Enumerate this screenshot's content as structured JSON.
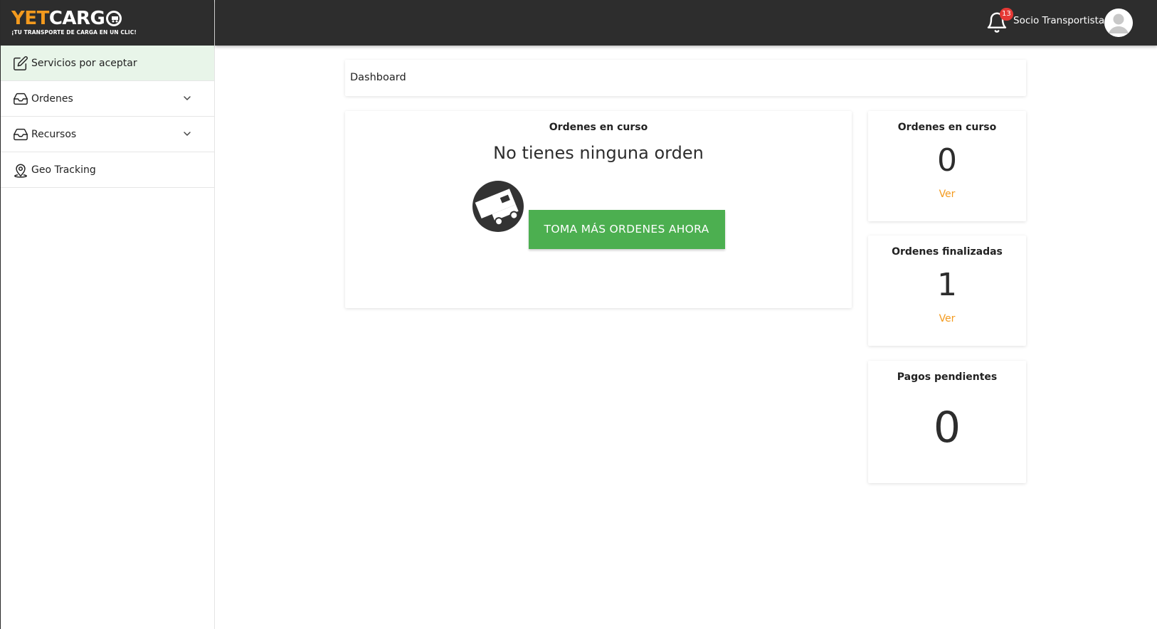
{
  "brand": {
    "word_yet": "YET",
    "word_cargo": "CARG",
    "tagline": "¡TU TRANSPORTE DE CARGA EN UN CLIC!",
    "accent_color": "#f39a1e"
  },
  "sidebar": {
    "items": [
      {
        "label": "Servicios por aceptar",
        "icon": "edit-icon",
        "active": true
      },
      {
        "label": "Ordenes",
        "icon": "inbox-icon",
        "expandable": true
      },
      {
        "label": "Recursos",
        "icon": "inbox-icon",
        "expandable": true
      },
      {
        "label": "Geo Tracking",
        "icon": "location-pin-icon"
      }
    ]
  },
  "header": {
    "notifications_count": "13",
    "user_name": "Socio Transportista"
  },
  "breadcrumb": "Dashboard",
  "main_card": {
    "title": "Ordenes en curso",
    "empty_message": "No tienes ninguna orden",
    "icon": "truck-icon",
    "cta_label": "TOMA MÁS ORDENES AHORA",
    "cta_color": "#4caf50"
  },
  "stats": [
    {
      "title": "Ordenes en curso",
      "value": "0",
      "link": "Ver"
    },
    {
      "title": "Ordenes finalizadas",
      "value": "1",
      "link": "Ver"
    },
    {
      "title": "Pagos pendientes",
      "value": "0"
    }
  ]
}
